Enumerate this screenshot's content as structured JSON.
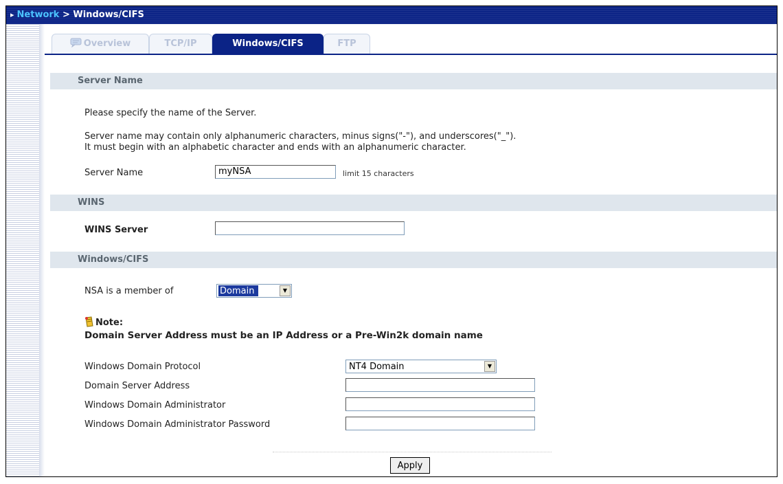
{
  "breadcrumb": {
    "parent": "Network",
    "separator": " > ",
    "current": "Windows/CIFS"
  },
  "tabs": [
    {
      "label": "Overview",
      "icon": "chat-bubble-icon",
      "active": false
    },
    {
      "label": "TCP/IP",
      "active": false
    },
    {
      "label": "Windows/CIFS",
      "active": true
    },
    {
      "label": "FTP",
      "active": false
    }
  ],
  "server_name_section": {
    "header": "Server Name",
    "intro": "Please specify the name of the Server.",
    "rule_line1": "Server name may contain only alphanumeric characters, minus signs(\"-\"), and underscores(\"_\").",
    "rule_line2": "It must begin with an alphabetic character and ends with an alphanumeric character.",
    "label": "Server Name",
    "value": "myNSA",
    "hint": "limit 15 characters"
  },
  "wins_section": {
    "header": "WINS",
    "label": "WINS Server",
    "value": ""
  },
  "cifs_section": {
    "header": "Windows/CIFS",
    "member_label": "NSA is a member of",
    "member_value": "Domain",
    "note_title": "Note:",
    "note_text": "Domain Server Address must be an IP Address or a Pre-Win2k domain name",
    "protocol_label": "Windows Domain Protocol",
    "protocol_value": "NT4 Domain",
    "server_address_label": "Domain Server Address",
    "server_address_value": "",
    "admin_label": "Windows Domain Administrator",
    "admin_value": "",
    "password_label": "Windows Domain Administrator Password",
    "password_value": ""
  },
  "actions": {
    "apply_label": "Apply"
  },
  "colors": {
    "titlebar": "#0b2386",
    "breadcrumb_link": "#4cc3ff",
    "section_header_bg": "#dfe6ed",
    "select_highlight": "#1c3a9e"
  }
}
